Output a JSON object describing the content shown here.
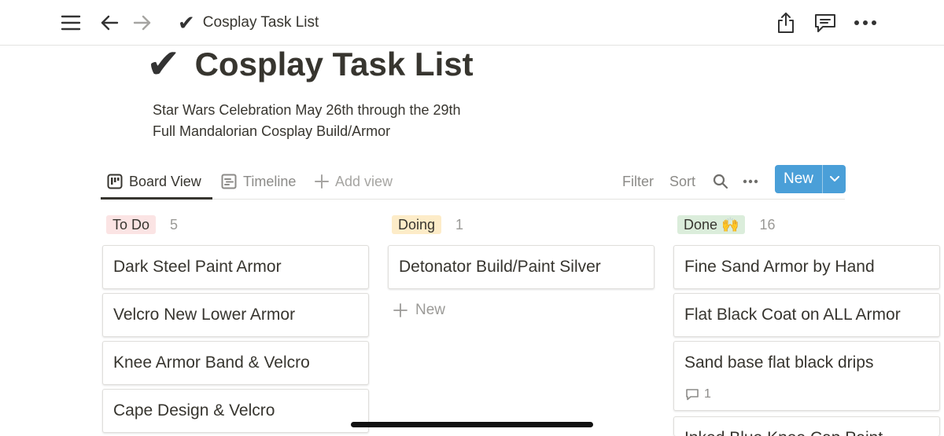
{
  "topbar": {
    "title_check": "✔",
    "title": "Cosplay Task List"
  },
  "page": {
    "title_check": "✔",
    "title": "Cosplay Task List",
    "description_line1": "Star Wars Celebration May 26th through the 29th",
    "description_line2": "Full Mandalorian Cosplay Build/Armor"
  },
  "views": {
    "board_label": "Board View",
    "timeline_label": "Timeline",
    "add_view_label": "Add view",
    "filter_label": "Filter",
    "sort_label": "Sort",
    "new_label": "New"
  },
  "board": {
    "columns": [
      {
        "tag": "To Do",
        "tag_color": "#fbe4e4",
        "count": "5",
        "cards": [
          "Dark Steel Paint Armor",
          "Velcro New Lower Armor",
          "Knee Armor Band & Velcro",
          "Cape Design & Velcro"
        ]
      },
      {
        "tag": "Doing",
        "tag_color": "#fdecc8",
        "count": "1",
        "cards": [
          "Detonator Build/Paint Silver"
        ],
        "new_label": "New"
      },
      {
        "tag": "Done 🙌",
        "tag_color": "#dbeddb",
        "count": "16",
        "cards": [
          "Fine Sand Armor by Hand",
          "Flat Black Coat on ALL Armor",
          "Sand base flat black drips",
          "Inked Blue Knee Cap Paint"
        ],
        "comment_count": "1"
      }
    ]
  },
  "colors": {
    "accent": "#4a9fd8",
    "text": "#37352f",
    "muted": "#8c8b88"
  }
}
